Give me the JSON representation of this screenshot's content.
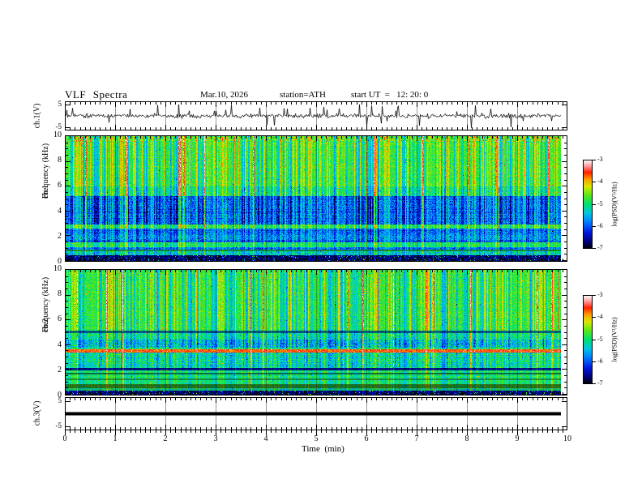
{
  "header": {
    "title": "VLF Spectra",
    "date": "Mar.10, 2026",
    "station": "station=ATH",
    "start_ut": "start UT  =   12: 20: 0"
  },
  "x_axis": {
    "label": "Time  (min)",
    "min": 0,
    "max": 10,
    "minor_step": 0.1,
    "data_end_min": 9.85,
    "major_ticks": [
      {
        "label": "0",
        "value": 0
      },
      {
        "label": "1",
        "value": 1
      },
      {
        "label": "2",
        "value": 2
      },
      {
        "label": "3",
        "value": 3
      },
      {
        "label": "4",
        "value": 4
      },
      {
        "label": "5",
        "value": 5
      },
      {
        "label": "6",
        "value": 6
      },
      {
        "label": "7",
        "value": 7
      },
      {
        "label": "8",
        "value": 8
      },
      {
        "label": "9",
        "value": 9
      },
      {
        "label": "10",
        "value": 10
      }
    ]
  },
  "palette": {
    "description": "rainbow PSD colormap: black (-7) -> blue -> cyan -> green -> yellow -> orange -> red -> pink -> white (-3)",
    "stops": [
      [
        0.0,
        "#000005"
      ],
      [
        0.07,
        "#00006e"
      ],
      [
        0.18,
        "#0018e0"
      ],
      [
        0.3,
        "#0080ff"
      ],
      [
        0.4,
        "#00c8e0"
      ],
      [
        0.5,
        "#00e070"
      ],
      [
        0.6,
        "#58e818"
      ],
      [
        0.7,
        "#d8e800"
      ],
      [
        0.78,
        "#ffa000"
      ],
      [
        0.86,
        "#ff2000"
      ],
      [
        0.93,
        "#ff9898"
      ],
      [
        1.0,
        "#ffffff"
      ]
    ]
  },
  "chart_data": [
    {
      "type": "line",
      "id": "ch1_waveform",
      "ylabel": "ch.1(V)",
      "ylim": [
        -5,
        5
      ],
      "yticks": [
        {
          "label": "5",
          "value": 5
        },
        {
          "label": "-5",
          "value": -5
        }
      ],
      "signal": {
        "kind": "broadband noise with impulsive sferic spikes",
        "mean_V": 0,
        "sigma_V": 0.5,
        "spike_prob": 0.045,
        "spike_max_V": 5,
        "down_bias": 0.55,
        "seed": 20260310
      }
    },
    {
      "type": "heatmap",
      "id": "ch1_spectrogram",
      "ylabel1": "ch.1",
      "ylabel2": "Frequency (kHz)",
      "ylim": [
        0,
        10
      ],
      "yticks": [
        {
          "label": "10",
          "value": 10
        },
        {
          "label": "8",
          "value": 8
        },
        {
          "label": "6",
          "value": 6
        },
        {
          "label": "4",
          "value": 4
        },
        {
          "label": "2",
          "value": 2
        },
        {
          "label": "0",
          "value": 0
        }
      ],
      "colorbar": {
        "label": "log(PSD)(V²/Hz)",
        "vmin": -7,
        "vmax": -3,
        "ticks": [
          {
            "label": "-3",
            "value": -3
          },
          {
            "label": "-4",
            "value": -4
          },
          {
            "label": "-5",
            "value": -5
          },
          {
            "label": "-6",
            "value": -6
          },
          {
            "label": "-7",
            "value": -7
          }
        ]
      },
      "seed": 41,
      "streaks": {
        "red_p": 0.03,
        "yellow_p": 0.2,
        "dark_p": 0.16
      },
      "bands": [
        {
          "f": [
            9.6,
            10.0
          ],
          "psd": -4.6,
          "noise": 0.5,
          "row_noise": 0.1,
          "streak": 1.0
        },
        {
          "f": [
            6.0,
            9.6
          ],
          "psd": -4.72,
          "noise": 0.28,
          "row_noise": 0.08,
          "streak": 1.0
        },
        {
          "f": [
            5.2,
            6.0
          ],
          "psd": -5.0,
          "noise": 0.32,
          "row_noise": 0.08,
          "streak": 1.0
        },
        {
          "f": [
            2.9,
            5.2
          ],
          "psd": -5.9,
          "noise": 0.4,
          "row_noise": 0.12,
          "streak": 0.9
        },
        {
          "f": [
            2.55,
            2.9
          ],
          "psd": -4.8,
          "noise": 0.28,
          "row_noise": 0.08,
          "streak": 0.7
        },
        {
          "f": [
            1.45,
            2.55
          ],
          "psd": -5.8,
          "noise": 0.4,
          "row_noise": 0.24,
          "streak": 0.6
        },
        {
          "f": [
            1.05,
            1.45
          ],
          "psd": -4.92,
          "noise": 0.28,
          "row_noise": 0.12,
          "streak": 0.5
        },
        {
          "f": [
            0.9,
            1.05
          ],
          "psd": -5.8,
          "noise": 0.32,
          "row_noise": 0.1,
          "streak": 0.5
        },
        {
          "f": [
            0.78,
            0.9
          ],
          "psd": -5.0,
          "noise": 0.2,
          "row_noise": 0.05,
          "streak": 0.3,
          "bright": 0.6
        },
        {
          "f": [
            0.4,
            0.78
          ],
          "psd": -5.3,
          "noise": 0.48,
          "row_noise": 0.2,
          "streak": 0.5
        },
        {
          "f": [
            0.0,
            0.4
          ],
          "psd": -6.72,
          "noise": 0.36,
          "row_noise": 0.05,
          "streak": 0.2,
          "speckle_p": 0.05,
          "speckle_amp": 1.6
        }
      ]
    },
    {
      "type": "heatmap",
      "id": "ch2_spectrogram",
      "ylabel1": "ch.2",
      "ylabel2": "Frequency (kHz)",
      "ylim": [
        0,
        10
      ],
      "yticks": [
        {
          "label": "10",
          "value": 10
        },
        {
          "label": "8",
          "value": 8
        },
        {
          "label": "6",
          "value": 6
        },
        {
          "label": "4",
          "value": 4
        },
        {
          "label": "2",
          "value": 2
        },
        {
          "label": "0",
          "value": 0
        }
      ],
      "colorbar": {
        "label": "log(PSD)(V²/Hz)",
        "vmin": -7,
        "vmax": -3,
        "ticks": [
          {
            "label": "-3",
            "value": -3
          },
          {
            "label": "-4",
            "value": -4
          },
          {
            "label": "-5",
            "value": -5
          },
          {
            "label": "-6",
            "value": -6
          },
          {
            "label": "-7",
            "value": -7
          }
        ]
      },
      "seed": 77,
      "streaks": {
        "red_p": 0.025,
        "yellow_p": 0.2,
        "dark_p": 0.15
      },
      "bands": [
        {
          "f": [
            5.15,
            10.0
          ],
          "psd": -4.8,
          "noise": 0.28,
          "row_noise": 0.08,
          "streak": 1.0
        },
        {
          "f": [
            4.95,
            5.15
          ],
          "psd": -5.6,
          "noise": 0.3,
          "row_noise": 0.05,
          "streak": 0.5,
          "bright": 0.55
        },
        {
          "f": [
            4.4,
            4.95
          ],
          "psd": -5.1,
          "noise": 0.34,
          "row_noise": 0.06,
          "streak": 0.8
        },
        {
          "f": [
            3.75,
            4.4
          ],
          "psd": -5.45,
          "noise": 0.48,
          "row_noise": 0.1,
          "streak": 0.8
        },
        {
          "f": [
            3.6,
            3.75
          ],
          "psd": -5.0,
          "noise": 0.3,
          "row_noise": 0.05,
          "streak": 0.7
        },
        {
          "f": [
            3.35,
            3.6
          ],
          "psd": -3.65,
          "noise": 0.25,
          "row_noise": 0.05,
          "streak": 0.2
        },
        {
          "f": [
            2.1,
            3.35
          ],
          "psd": -5.2,
          "noise": 0.4,
          "row_noise": 0.16,
          "streak": 0.7
        },
        {
          "f": [
            1.9,
            2.1
          ],
          "psd": -6.3,
          "noise": 0.3,
          "row_noise": 0.06,
          "streak": 0.3,
          "bright": 0.6
        },
        {
          "f": [
            1.75,
            1.9
          ],
          "psd": -5.0,
          "noise": 0.3,
          "row_noise": 0.06,
          "streak": 0.5
        },
        {
          "f": [
            1.6,
            1.75
          ],
          "psd": -5.1,
          "noise": 0.25,
          "row_noise": 0.05,
          "streak": 0.4,
          "bright": 0.5
        },
        {
          "f": [
            1.3,
            1.6
          ],
          "psd": -5.0,
          "noise": 0.3,
          "row_noise": 0.12,
          "streak": 0.5
        },
        {
          "f": [
            1.12,
            1.3
          ],
          "psd": -4.9,
          "noise": 0.25,
          "row_noise": 0.06,
          "streak": 0.4,
          "bright": 0.65
        },
        {
          "f": [
            0.8,
            1.12
          ],
          "psd": -5.0,
          "noise": 0.3,
          "row_noise": 0.08,
          "streak": 0.5
        },
        {
          "f": [
            0.5,
            0.8
          ],
          "psd": -4.75,
          "noise": 0.3,
          "row_noise": 0.08,
          "streak": 0.4,
          "bright": 0.5
        },
        {
          "f": [
            0.28,
            0.5
          ],
          "psd": -5.1,
          "noise": 0.4,
          "row_noise": 0.08,
          "streak": 0.4,
          "bright": 0.85
        },
        {
          "f": [
            0.0,
            0.28
          ],
          "psd": -6.7,
          "noise": 0.4,
          "row_noise": 0.05,
          "streak": 0.2,
          "speckle_p": 0.07,
          "speckle_amp": 1.8
        }
      ]
    },
    {
      "type": "line",
      "id": "ch3_waveform",
      "ylabel": "ch.3(V)",
      "ylim": [
        -5,
        5
      ],
      "yticks": [
        {
          "label": "5",
          "value": 5
        },
        {
          "label": "-5",
          "value": -5
        }
      ],
      "signal": {
        "kind": "constant flat trace",
        "value_V": 0,
        "line_thickness_px": 4
      }
    }
  ]
}
